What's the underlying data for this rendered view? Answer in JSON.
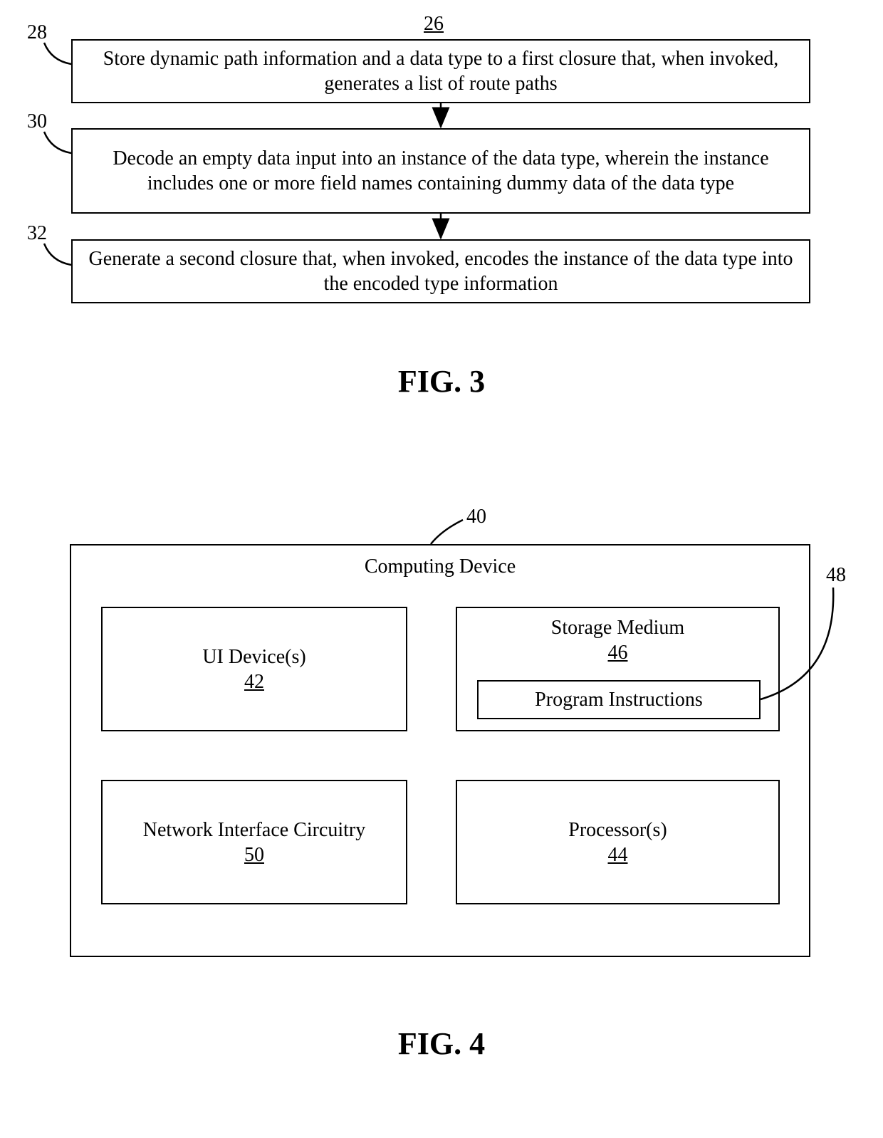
{
  "fig3": {
    "top_ref": "26",
    "steps": [
      {
        "ref": "28",
        "text": "Store dynamic path information and a data type to a first closure that, when invoked, generates a list of route paths"
      },
      {
        "ref": "30",
        "text": "Decode an empty data input into an instance of the data type, wherein the instance includes one or more field names containing dummy data of the data type"
      },
      {
        "ref": "32",
        "text": "Generate a second closure that, when invoked, encodes the instance of the data type into the encoded type information"
      }
    ],
    "caption": "FIG. 3"
  },
  "fig4": {
    "ref": "40",
    "title": "Computing Device",
    "boxes": {
      "ui": {
        "label": "UI Device(s)",
        "num": "42"
      },
      "storage": {
        "label": "Storage Medium",
        "num": "46",
        "inner": {
          "label": "Program Instructions",
          "ref": "48"
        }
      },
      "net": {
        "label": "Network Interface Circuitry",
        "num": "50"
      },
      "proc": {
        "label": "Processor(s)",
        "num": "44"
      }
    },
    "caption": "FIG. 4"
  }
}
